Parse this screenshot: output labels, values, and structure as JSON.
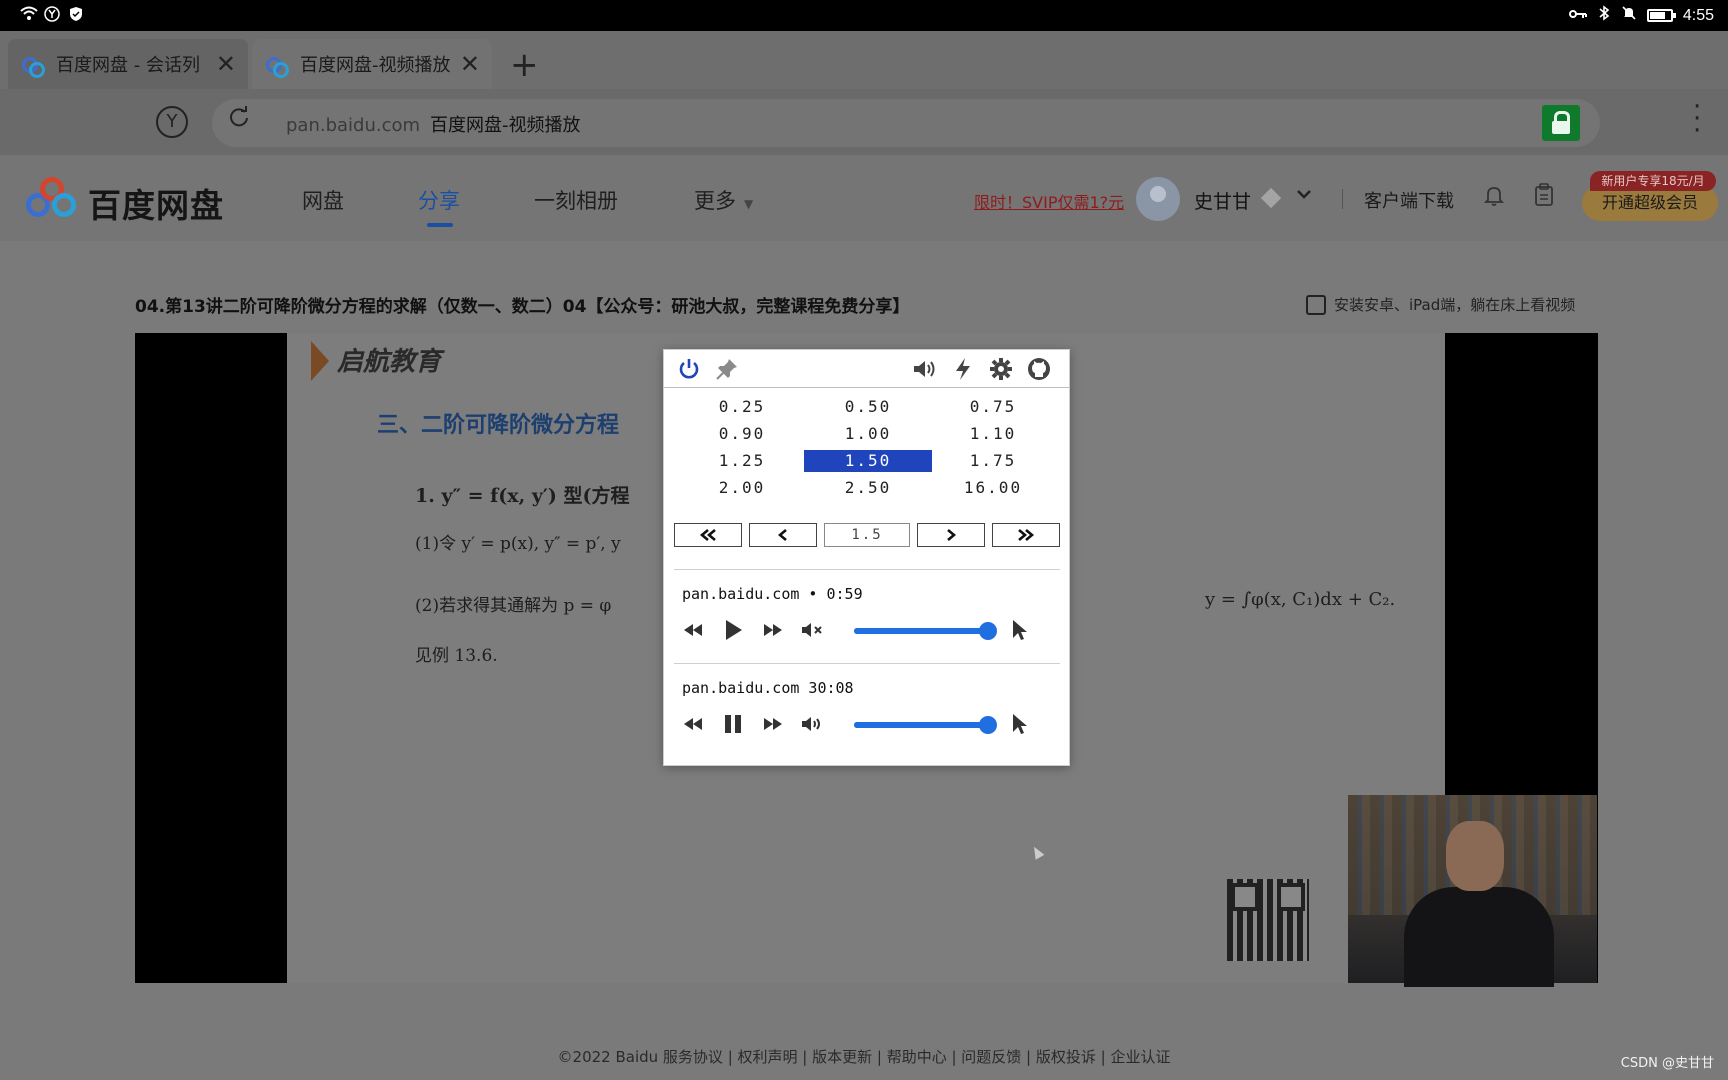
{
  "status_bar": {
    "time": "4:55"
  },
  "tabs": [
    {
      "title": "百度网盘 - 会话列",
      "close": "✕"
    },
    {
      "title": "百度网盘-视频播放",
      "close": "✕"
    }
  ],
  "new_tab": "+",
  "address": {
    "domain": "pan.baidu.com",
    "page_title": "百度网盘-视频播放",
    "y_label": "Y"
  },
  "header": {
    "logo": "百度网盘",
    "nav": [
      "网盘",
      "分享",
      "一刻相册",
      "更多"
    ],
    "promo": "限时！SVIP仅需1?元",
    "username": "史甘甘",
    "client_download": "客户端下载",
    "vip_button": "开通超级会员",
    "vip_badge": "新用户专享18元/月"
  },
  "video": {
    "title": "04.第13讲二阶可降阶微分方程的求解（仅数一、数二）04【公众号：研池大叔，完整课程免费分享】",
    "install_hint": "安装安卓、iPad端，躺在床上看视频",
    "slide": {
      "brand": "启航教育",
      "heading": "三、二阶可降阶微分方程",
      "line1": "1.  y″ = f(x, y′) 型(方程",
      "line2": "(1)令 y′ = p(x), y″ = p′, y",
      "line3": "(2)若求得其通解为 p = φ",
      "line3_right": "y = ∫φ(x, C₁)dx + C₂.",
      "line4": "见例 13.6."
    }
  },
  "speed_popup": {
    "speeds": [
      "0.25",
      "0.50",
      "0.75",
      "0.90",
      "1.00",
      "1.10",
      "1.25",
      "1.50",
      "1.75",
      "2.00",
      "2.50",
      "16.00"
    ],
    "selected_speed": "1.50",
    "current_value": "1.5",
    "media": [
      {
        "label": "pan.baidu.com • 0:59",
        "state": "paused",
        "muted": true,
        "volume": 1.0
      },
      {
        "label": "pan.baidu.com 30:08",
        "state": "playing",
        "muted": false,
        "volume": 1.0
      }
    ],
    "accent_color": "#1f44bb"
  },
  "footer": "©2022 Baidu  服务协议 | 权利声明 | 版本更新 | 帮助中心 | 问题反馈 | 版权投诉 | 企业认证",
  "watermark": "CSDN @史甘甘"
}
